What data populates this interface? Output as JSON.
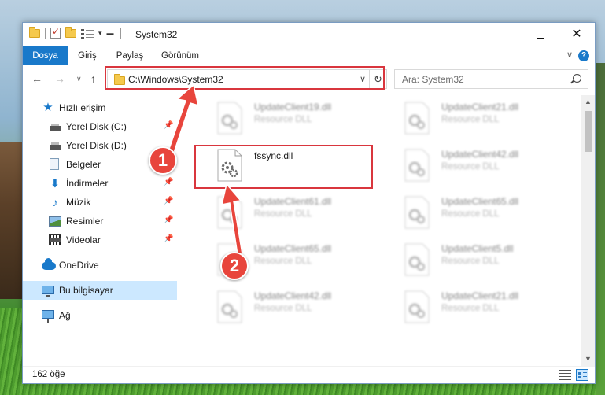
{
  "window": {
    "title": "System32",
    "controls": {
      "minimize": "minimize-icon",
      "maximize": "maximize-icon",
      "close": "close-icon"
    }
  },
  "ribbon": {
    "tabs": [
      {
        "label": "Dosya",
        "active": true
      },
      {
        "label": "Giriş"
      },
      {
        "label": "Paylaş"
      },
      {
        "label": "Görünüm"
      }
    ],
    "help": "?"
  },
  "address_bar": {
    "path": "C:\\Windows\\System32"
  },
  "search": {
    "placeholder": "Ara: System32"
  },
  "sidebar": {
    "items": [
      {
        "label": "Hızlı erişim",
        "icon": "star-icon"
      },
      {
        "label": "Yerel Disk (C:)",
        "icon": "disk-icon",
        "pinned": true
      },
      {
        "label": "Yerel Disk (D:)",
        "icon": "disk-icon",
        "pinned": false
      },
      {
        "label": "Belgeler",
        "icon": "document-icon",
        "pinned": false
      },
      {
        "label": "İndirmeler",
        "icon": "download-icon",
        "pinned": true
      },
      {
        "label": "Müzik",
        "icon": "music-icon",
        "pinned": true
      },
      {
        "label": "Resimler",
        "icon": "pictures-icon",
        "pinned": true
      },
      {
        "label": "Videolar",
        "icon": "video-icon",
        "pinned": true
      },
      {
        "label": "OneDrive",
        "icon": "cloud-icon"
      },
      {
        "label": "Bu bilgisayar",
        "icon": "computer-icon",
        "selected": true
      },
      {
        "label": "Ağ",
        "icon": "network-icon"
      }
    ]
  },
  "files": [
    {
      "name": "UpdateClient19.dll",
      "type": "Resource DLL",
      "blurred": true
    },
    {
      "name": "UpdateClient21.dll",
      "type": "Resource DLL",
      "blurred": true
    },
    {
      "name": "fssync.dll",
      "type": "",
      "blurred": false
    },
    {
      "name": "UpdateClient42.dll",
      "type": "Resource DLL",
      "blurred": true
    },
    {
      "name": "UpdateClient61.dll",
      "type": "Resource DLL",
      "blurred": true
    },
    {
      "name": "UpdateClient65.dll",
      "type": "Resource DLL",
      "blurred": true
    },
    {
      "name": "UpdateClient65.dll",
      "type": "Resource DLL",
      "blurred": true
    },
    {
      "name": "UpdateClient5.dll",
      "type": "Resource DLL",
      "blurred": true
    },
    {
      "name": "UpdateClient42.dll",
      "type": "Resource DLL",
      "blurred": true
    },
    {
      "name": "UpdateClient21.dll",
      "type": "Resource DLL",
      "blurred": true
    }
  ],
  "status": {
    "item_count": "162 öğe"
  },
  "annotations": {
    "step1": "1",
    "step2": "2",
    "highlight_color": "#d9363e",
    "badge_color": "#e8453c"
  },
  "colors": {
    "accent": "#1979ca",
    "selection": "#cce8ff"
  }
}
